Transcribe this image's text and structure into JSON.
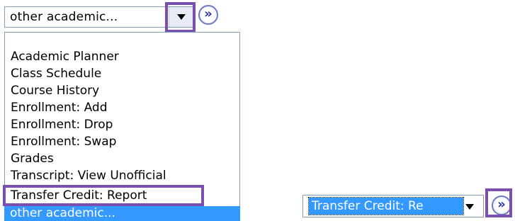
{
  "left_select": {
    "value": "other academic...",
    "icon": "chevron-down-icon"
  },
  "go_icon_text": "»",
  "dropdown": {
    "options": [
      "Academic Planner",
      "Class Schedule",
      "Course History",
      "Enrollment: Add",
      "Enrollment: Drop",
      "Enrollment: Swap",
      "Grades",
      "Transcript: View Unofficial",
      "Transfer Credit: Report",
      "other academic..."
    ],
    "selected_option": "other academic..."
  },
  "right_select": {
    "value": "Transfer Credit: Re"
  },
  "colors": {
    "highlight_border": "#7b4fb0",
    "selection_bg": "#3399ff"
  }
}
